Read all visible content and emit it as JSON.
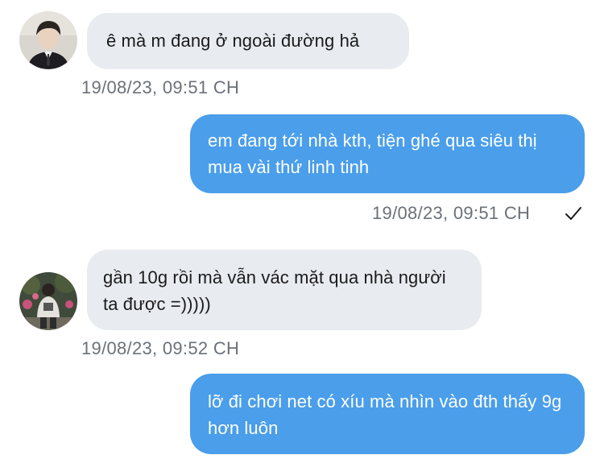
{
  "messages": [
    {
      "direction": "incoming",
      "avatar": "avatar-dark-suit-person",
      "text": "ê mà m đang ở ngoài đường hả",
      "timestamp": "19/08/23, 09:51 CH"
    },
    {
      "direction": "outgoing",
      "text": "em đang tới nhà kth, tiện ghé qua siêu thị mua vài thứ linh tinh",
      "timestamp": "19/08/23, 09:51 CH",
      "status_icon": "check-icon"
    },
    {
      "direction": "incoming",
      "avatar": "avatar-outdoor-person",
      "text": "gần 10g rồi mà vẫn vác mặt qua nhà người ta được =)))))",
      "timestamp": "19/08/23, 09:52 CH"
    },
    {
      "direction": "outgoing",
      "text": "lỡ đi chơi net có xíu mà nhìn vào đth thấy 9g hơn luôn"
    }
  ],
  "colors": {
    "incoming_bubble": "#e8ebf0",
    "outgoing_bubble": "#4a9eea",
    "timestamp": "#6b7178"
  }
}
